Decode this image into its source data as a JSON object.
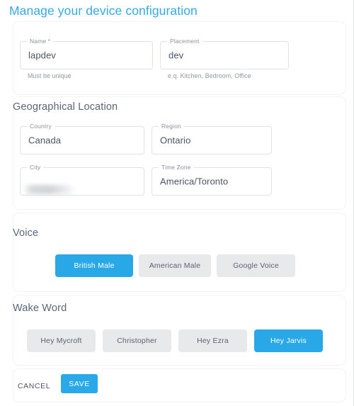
{
  "page": {
    "title": "Manage your device configuration",
    "title_color": "#36a9e8",
    "accent_color": "#29a8e8",
    "chip_idle_color": "#e7e9eb"
  },
  "device_section": {
    "fields": [
      {
        "label": "Name *",
        "value": "lapdev",
        "helper": "Must be unique",
        "redacted": false
      },
      {
        "label": "Placement",
        "value": "dev",
        "helper": "e.q. Kitchen, Bedroom, Office",
        "redacted": false
      }
    ]
  },
  "geo_section": {
    "heading": "Geographical Location",
    "fields": [
      {
        "label": "Country",
        "value": "Canada",
        "helper": "",
        "redacted": false
      },
      {
        "label": "Region",
        "value": "Ontario",
        "helper": "",
        "redacted": false
      },
      {
        "label": "City",
        "value": "",
        "helper": "",
        "redacted": true
      },
      {
        "label": "Time Zone",
        "value": "America/Toronto",
        "helper": "",
        "redacted": false
      }
    ]
  },
  "voice_section": {
    "heading": "Voice",
    "options": [
      {
        "label": "British Male",
        "selected": true
      },
      {
        "label": "American Male",
        "selected": false
      },
      {
        "label": "Google Voice",
        "selected": false
      }
    ]
  },
  "wake_word_section": {
    "heading": "Wake Word",
    "options": [
      {
        "label": "Hey Mycroft",
        "selected": false
      },
      {
        "label": "Christopher",
        "selected": false
      },
      {
        "label": "Hey Ezra",
        "selected": false
      },
      {
        "label": "Hey Jarvis",
        "selected": true
      }
    ]
  },
  "footer": {
    "cancel_label": "CANCEL",
    "save_label": "SAVE"
  }
}
